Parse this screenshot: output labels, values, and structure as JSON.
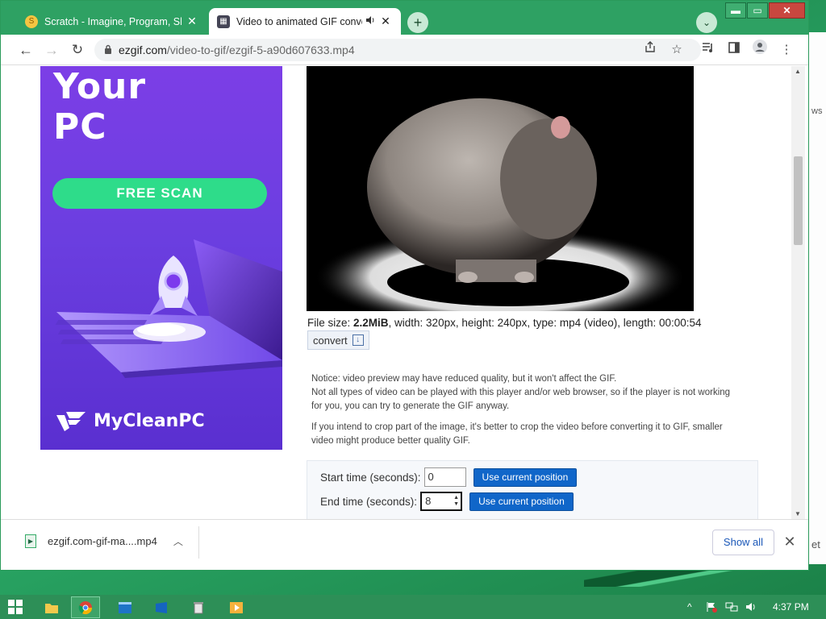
{
  "browser": {
    "tabs": [
      {
        "label": "Scratch - Imagine, Program, Share",
        "close": "✕"
      },
      {
        "label": "Video to animated GIF converter",
        "close": "✕"
      }
    ],
    "new_tab": "+",
    "window_controls": {
      "minimize": "▬",
      "maximize": "▭",
      "close": "✕"
    }
  },
  "toolbar": {
    "url_host": "ezgif.com",
    "url_path": "/video-to-gif/ezgif-5-a90d607633.mp4"
  },
  "ad": {
    "headline_line1": "Your",
    "headline_line2": "PC",
    "cta": "FREE SCAN",
    "brand": "MyCleanPC",
    "colors": {
      "background": "#6b3ee0",
      "cta": "#2edc8a"
    }
  },
  "file_info": {
    "label": "File size: ",
    "size": "2.2MiB",
    "rest": ", width: 320px, height: 240px, type: mp4 (video), length: 00:00:54"
  },
  "convert": {
    "label": "convert"
  },
  "notice": {
    "p1": "Notice: video preview may have reduced quality, but it won't affect the GIF.",
    "p2": "Not all types of video can be played with this player and/or web browser, so if the player is not working for you, you can try to generate the GIF anyway.",
    "p3": "If you intend to crop part of the image, it's better to crop the video before converting it to GIF, smaller video might produce better quality GIF."
  },
  "time_controls": {
    "start_label": "Start time (seconds):",
    "start_value": "0",
    "end_label": "End time (seconds):",
    "end_value": "8",
    "use_position": "Use current position"
  },
  "downloads": {
    "file": "ezgif.com-gif-ma....mp4",
    "show_all": "Show all"
  },
  "taskbar": {
    "clock": "4:37 PM"
  },
  "desktop_peek": {
    "line1": "ws",
    "line2": "et"
  }
}
